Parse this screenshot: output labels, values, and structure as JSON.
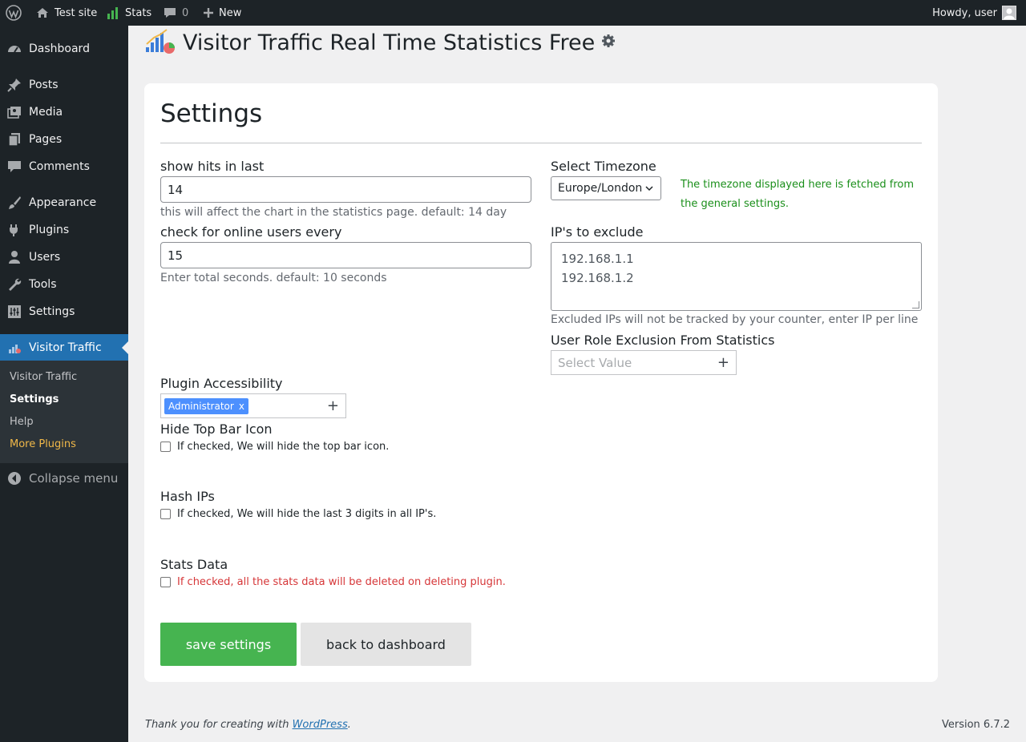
{
  "admin_bar": {
    "site_name": "Test site",
    "stats_label": "Stats",
    "comments_count": "0",
    "new_label": "New",
    "howdy": "Howdy, user"
  },
  "sidebar": {
    "items": [
      {
        "label": "Dashboard",
        "icon": "dashboard-icon"
      },
      {
        "label": "Posts",
        "icon": "pin-icon"
      },
      {
        "label": "Media",
        "icon": "media-icon"
      },
      {
        "label": "Pages",
        "icon": "pages-icon"
      },
      {
        "label": "Comments",
        "icon": "comment-icon"
      },
      {
        "label": "Appearance",
        "icon": "brush-icon"
      },
      {
        "label": "Plugins",
        "icon": "plug-icon"
      },
      {
        "label": "Users",
        "icon": "user-icon"
      },
      {
        "label": "Tools",
        "icon": "wrench-icon"
      },
      {
        "label": "Settings",
        "icon": "settings-icon"
      },
      {
        "label": "Visitor Traffic",
        "icon": "chart-icon"
      }
    ],
    "submenu": [
      "Visitor Traffic",
      "Settings",
      "Help",
      "More Plugins"
    ],
    "collapse_label": "Collapse menu"
  },
  "page": {
    "title": "Visitor Traffic Real Time Statistics Free"
  },
  "settings": {
    "heading": "Settings",
    "hits_label": "show hits in last",
    "hits_value": "14",
    "hits_help": "this will affect the chart in the statistics page. default: 14 day",
    "online_label": "check for online users every",
    "online_value": "15",
    "online_help": "Enter total seconds. default: 10 seconds",
    "timezone_label": "Select Timezone",
    "timezone_value": "Europe/London",
    "timezone_note_1": "The timezone displayed here is fetched from",
    "timezone_note_2": "the general settings.",
    "ip_label": "IP's to exclude",
    "ip_line_1": "192.168.1.1",
    "ip_line_2": "192.168.1.2",
    "ip_help": "Excluded IPs will not be tracked by your counter, enter IP per line",
    "role_label": "User Role Exclusion From Statistics",
    "role_placeholder": "Select Value",
    "access_label": "Plugin Accessibility",
    "access_tag": "Administrator",
    "access_tag_remove": "x",
    "topbar_label": "Hide Top Bar Icon",
    "topbar_help": "If checked, We will hide the top bar icon.",
    "hash_label": "Hash IPs",
    "hash_help": "If checked, We will hide the last 3 digits in all IP's.",
    "stats_label": "Stats Data",
    "stats_help": "If checked, all the stats data will be deleted on deleting plugin.",
    "save_button": "save settings",
    "back_button": "back to dashboard"
  },
  "footer": {
    "thanks_prefix": "Thank you for creating with ",
    "thanks_link": "WordPress",
    "thanks_suffix": ".",
    "version": "Version 6.7.2"
  },
  "colors": {
    "admin_bar": "#1d2327",
    "accent": "#2271b1",
    "save": "#46b450",
    "warning": "#d63638",
    "note": "#1a8f1a"
  }
}
